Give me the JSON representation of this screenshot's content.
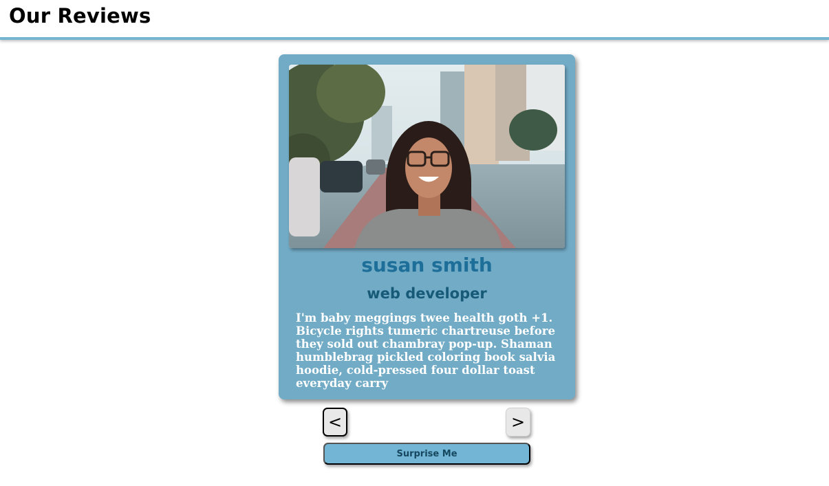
{
  "page": {
    "title": "Our Reviews"
  },
  "review": {
    "name": "susan smith",
    "job": "web developer",
    "text": "I'm baby meggings twee health goth +1. Bicycle rights tumeric chartreuse before they sold out chambray pop-up. Shaman humblebrag pickled coloring book salvia hoodie, cold-pressed four dollar toast everyday carry"
  },
  "controls": {
    "prev_label": "<",
    "next_label": ">",
    "surprise_label": "Surprise Me"
  },
  "colors": {
    "card_bg": "#72abc6",
    "header_border": "#75b5cf",
    "name": "#1d6f99",
    "job": "#175a78",
    "button_bg": "#72b5d5"
  },
  "icons": {
    "prev": "chevron-left",
    "next": "chevron-right"
  }
}
